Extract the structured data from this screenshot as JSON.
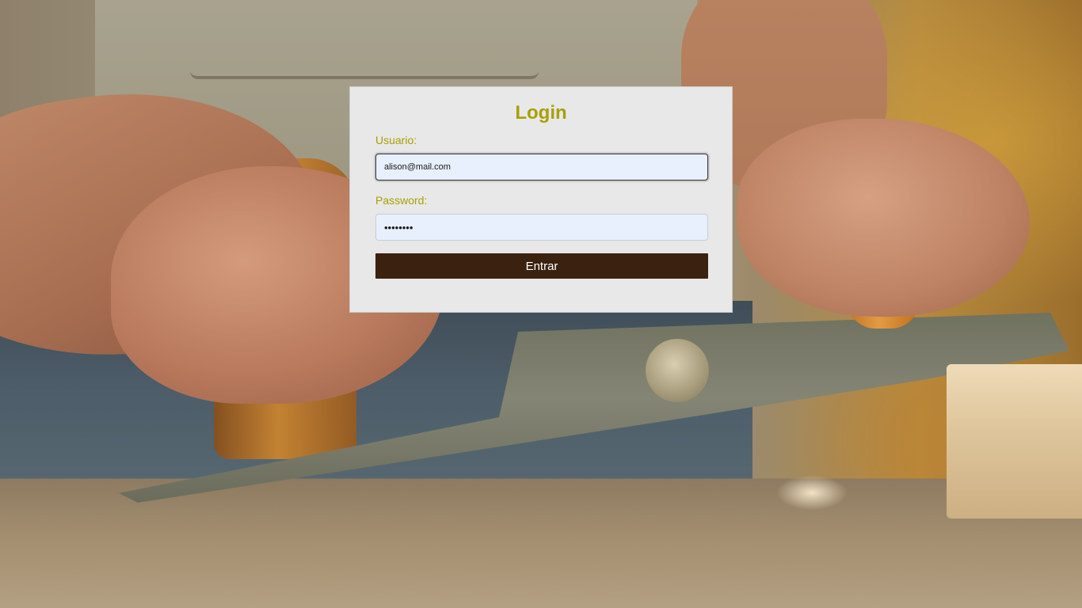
{
  "login": {
    "title": "Login",
    "username_label": "Usuario:",
    "username_value": "alison@mail.com",
    "password_label": "Password:",
    "password_value": "12345678",
    "submit_label": "Entrar"
  },
  "colors": {
    "title": "#a8a000",
    "labels": "#a8a000",
    "button_bg": "#3b2110",
    "button_text": "#ffffff",
    "card_bg": "#e8e8e8",
    "input_bg": "#e8effd"
  }
}
